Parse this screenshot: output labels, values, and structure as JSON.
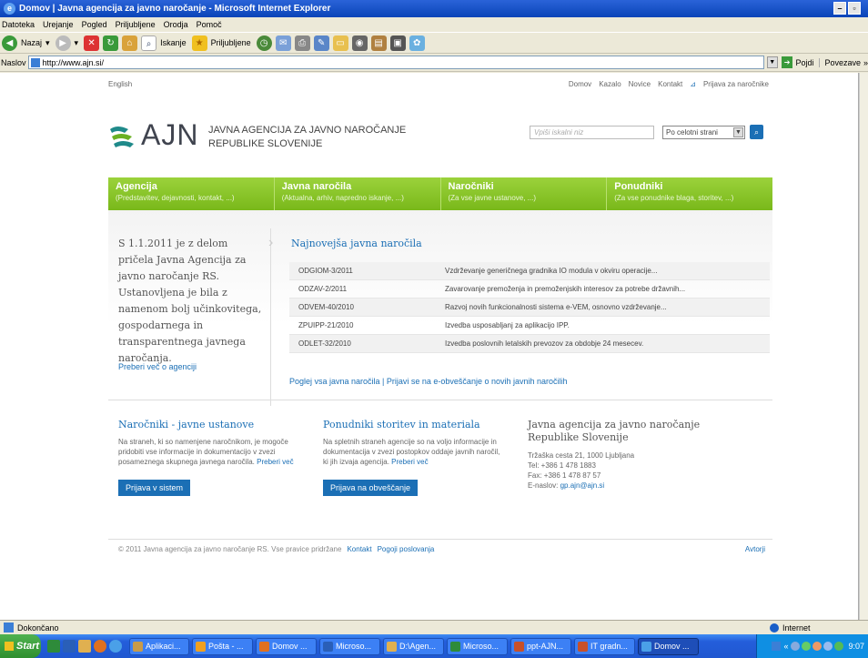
{
  "window": {
    "title": "Domov | Javna agencija za javno naročanje - Microsoft Internet Explorer",
    "min": "–",
    "max": "▫"
  },
  "menu": [
    "Datoteka",
    "Urejanje",
    "Pogled",
    "Priljubljene",
    "Orodja",
    "Pomoč"
  ],
  "toolbar": {
    "back": "Nazaj",
    "search": "Iskanje",
    "favorites": "Priljubljene"
  },
  "address": {
    "label": "Naslov",
    "url": "http://www.ajn.si/",
    "go": "Pojdi",
    "links": "Povezave"
  },
  "site": {
    "lang": "English",
    "util_links": [
      "Domov",
      "Kazalo",
      "Novice",
      "Kontakt",
      "Prijava za naročnike"
    ],
    "logo_text": "AJN",
    "logo_line1": "JAVNA AGENCIJA ZA JAVNO NAROČANJE",
    "logo_line2": "REPUBLIKE SLOVENIJE",
    "search_placeholder": "Vpiši iskalni niz",
    "search_scope": "Po celotni strani",
    "nav": [
      {
        "title": "Agencija",
        "sub": "(Predstavitev, dejavnosti, kontakt, ...)"
      },
      {
        "title": "Javna naročila",
        "sub": "(Aktualna, arhiv, napredno iskanje, ...)"
      },
      {
        "title": "Naročniki",
        "sub": "(Za vse javne ustanove, ...)"
      },
      {
        "title": "Ponudniki",
        "sub": "(Za vse ponudnike blaga, storitev, ...)"
      }
    ],
    "intro": "S 1.1.2011 je z delom pričela Javna Agencija za javno naročanje RS. Ustanovljena je bila z namenom bolj učinkovitega, gospodarnega in transparentnega javnega naročanja.",
    "intro_link": "Preberi več o agenciji",
    "tenders_title": "Najnovejša javna naročila",
    "tenders": [
      {
        "code": "ODGIOM-3/2011",
        "desc": "Vzdrževanje generičnega gradnika IO modula v okviru operacije..."
      },
      {
        "code": "ODZAV-2/2011",
        "desc": "Zavarovanje premoženja in premoženjskih interesov za potrebe državnih..."
      },
      {
        "code": "ODVEM-40/2010",
        "desc": "Razvoj novih funkcionalnosti sistema e-VEM, osnovno vzdrževanje..."
      },
      {
        "code": "ZPUIPP-21/2010",
        "desc": "Izvedba usposabljanj za aplikacijo IPP."
      },
      {
        "code": "ODLET-32/2010",
        "desc": "Izvedba poslovnih letalskih prevozov za obdobje 24 mesecev."
      }
    ],
    "tenders_foot": "Poglej vsa javna naročila | Prijavi se na e-obveščanje o novih javnih naročilih",
    "col1": {
      "title": "Naročniki - javne ustanove",
      "text": "Na straneh, ki so namenjene naročnikom, je mogoče pridobiti vse informacije in dokumentacijo v zvezi posameznega skupnega javnega naročila.",
      "link": "Preberi več",
      "button": "Prijava v sistem"
    },
    "col2": {
      "title": "Ponudniki storitev in materiala",
      "text": "Na spletnih straneh agencije so na voljo informacije in dokumentacija v zvezi postopkov oddaje javnih naročil, ki jih izvaja agencija.",
      "link": "Preberi več",
      "button": "Prijava na obveščanje"
    },
    "col3": {
      "title": "Javna agencija za javno naročanje Republike Slovenije",
      "address": "Tržaška cesta 21, 1000 Ljubljana",
      "tel": "Tel: +386 1 478 1883",
      "fax": "Fax: +386 1 478 87 57",
      "email_label": "E-naslov:",
      "email": "gp.ajn@ajn.si"
    },
    "footer": {
      "copyright": "© 2011 Javna agencija za javno naročanje RS. Vse pravice pridržane",
      "contact": "Kontakt",
      "terms": "Pogoji poslovanja",
      "authors": "Avtorji"
    }
  },
  "status": {
    "text": "Dokončano",
    "zone": "Internet"
  },
  "taskbar": {
    "start": "Start",
    "tasks": [
      "Aplikaci...",
      "Pošta - ...",
      "Domov ...",
      "Microso...",
      "D:\\Agen...",
      "Microso...",
      "ppt-AJN...",
      "IT gradn...",
      "Domov ..."
    ],
    "clock": "9:07"
  },
  "colors": {
    "brand_green": "#8cc63f",
    "link_blue": "#1b6fb5",
    "xp_blue": "#245edb"
  }
}
